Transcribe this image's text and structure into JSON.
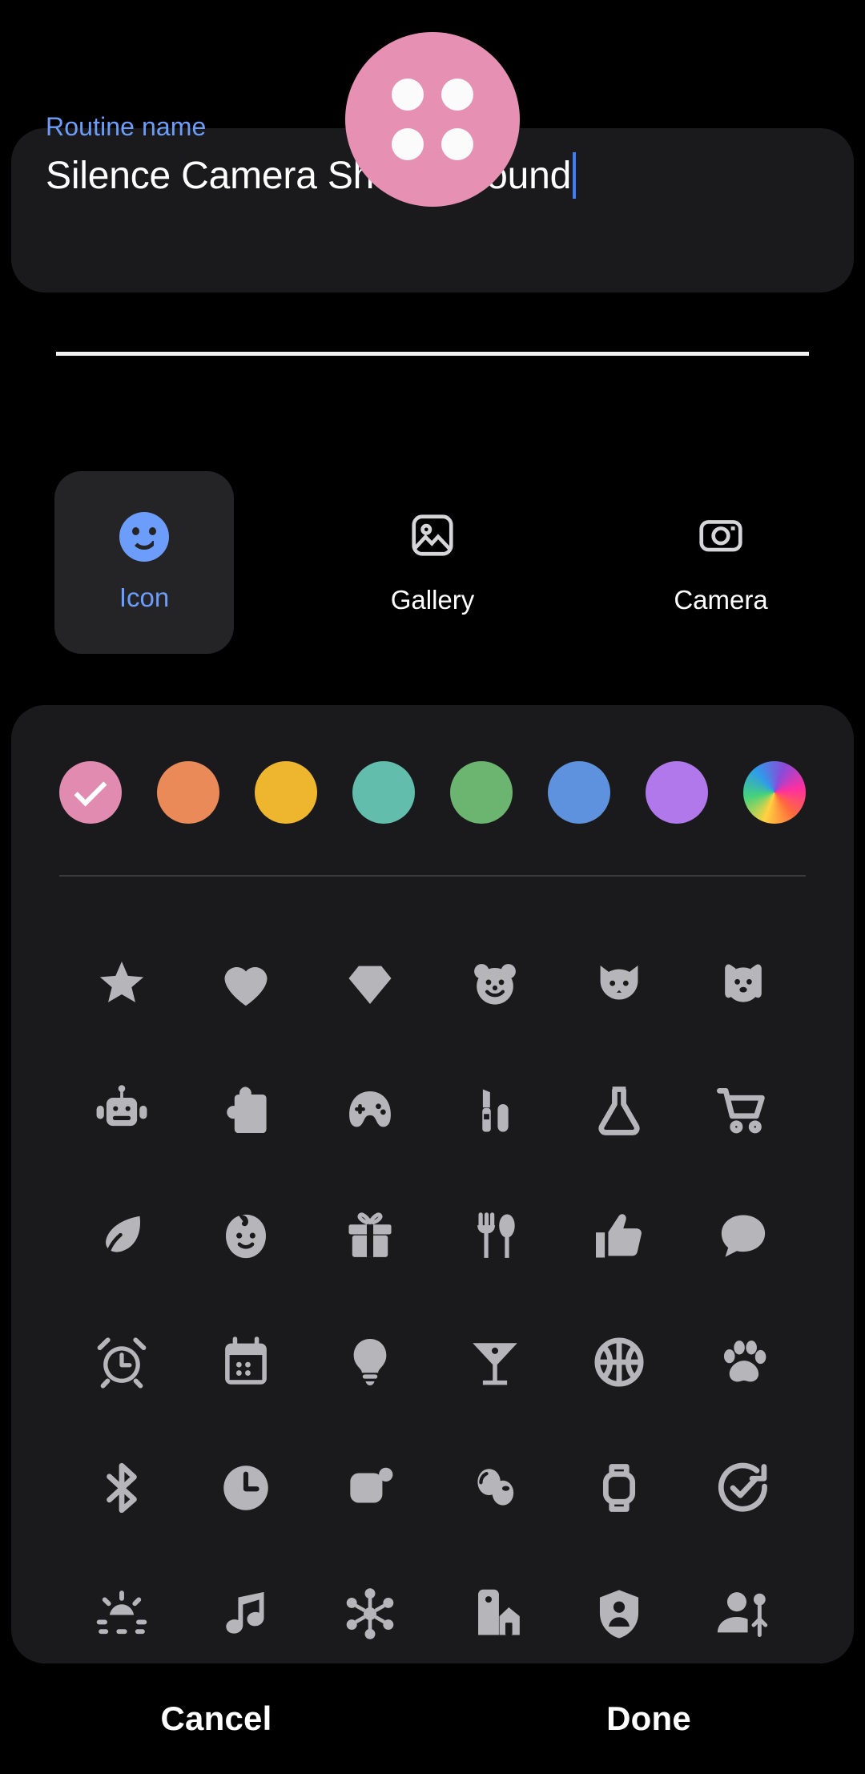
{
  "avatar": {
    "name": "routine-avatar",
    "color": "#e690b4",
    "icon": "four-dots-icon",
    "dot_color": "#fbfbfb",
    "dot_count": 4
  },
  "name_field": {
    "label": "Routine name",
    "value": "Silence Camera Shutter Sound",
    "placeholder": "Routine name",
    "label_color": "#6c9dfa",
    "caret_color": "#3b7dfb",
    "underline_color": "#f2f2f2"
  },
  "source_tabs": {
    "selected": "Icon",
    "items": [
      {
        "label": "Icon",
        "icon": "smiley-face-icon",
        "selected": true
      },
      {
        "label": "Gallery",
        "icon": "image-photo-icon",
        "selected": false
      },
      {
        "label": "Camera",
        "icon": "camera-icon",
        "selected": false
      }
    ],
    "selected_color": "#6c9dfa",
    "unselected_color": "#ffffff"
  },
  "color_swatches": {
    "selected_index": 0,
    "items": [
      {
        "name": "pink",
        "color": "#e18bb0",
        "selected": true
      },
      {
        "name": "orange",
        "color": "#e98a58",
        "selected": false
      },
      {
        "name": "yellow",
        "color": "#eeb52e",
        "selected": false
      },
      {
        "name": "teal",
        "color": "#63bdac",
        "selected": false
      },
      {
        "name": "green",
        "color": "#6bb571",
        "selected": false
      },
      {
        "name": "blue",
        "color": "#5e92de",
        "selected": false
      },
      {
        "name": "purple",
        "color": "#b078ea",
        "selected": false
      },
      {
        "name": "rainbow",
        "color": "#ff3ba7",
        "selected": false
      }
    ]
  },
  "icon_grid": {
    "columns": 6,
    "icon_color": "#b6b6ba",
    "rows": [
      [
        "star-icon",
        "heart-icon",
        "diamond-icon",
        "bear-face-icon",
        "cat-face-icon",
        "dog-face-icon"
      ],
      [
        "robot-icon",
        "puzzle-piece-icon",
        "gamepad-icon",
        "lipstick-icon",
        "flask-icon",
        "shopping-cart-icon"
      ],
      [
        "leaf-icon",
        "baby-face-icon",
        "gift-icon",
        "fork-spoon-icon",
        "thumbs-up-icon",
        "chat-bubble-icon"
      ],
      [
        "alarm-clock-icon",
        "calendar-icon",
        "lightbulb-icon",
        "cocktail-glass-icon",
        "basketball-icon",
        "paw-print-icon"
      ],
      [
        "bluetooth-icon",
        "clock-icon",
        "mouse-device-icon",
        "earbuds-icon",
        "smartwatch-icon",
        "check-circle-icon"
      ],
      [
        "brightness-icon",
        "music-note-icon",
        "hub-network-icon",
        "smart-home-icon",
        "shield-person-icon",
        "person-settings-icon"
      ]
    ]
  },
  "footer": {
    "cancel_label": "Cancel",
    "done_label": "Done"
  }
}
